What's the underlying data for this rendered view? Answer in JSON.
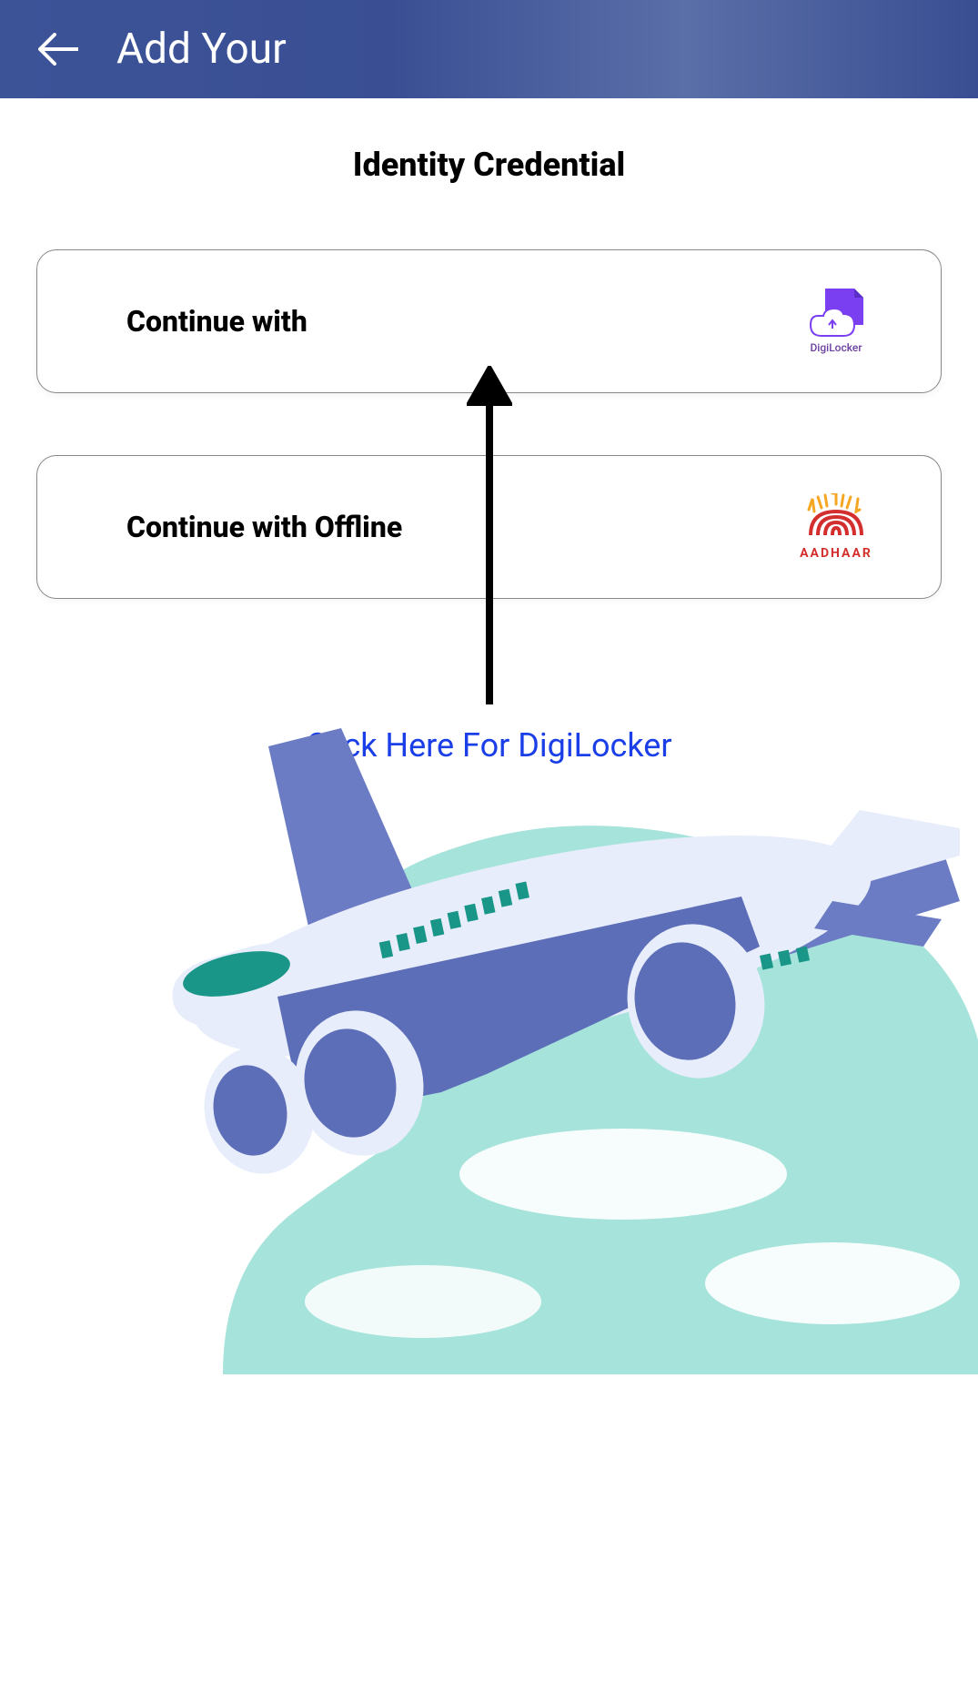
{
  "header": {
    "title": "Add Your"
  },
  "subtitle": "Identity Credential",
  "options": [
    {
      "label": "Continue with",
      "provider": "DigiLocker"
    },
    {
      "label": "Continue with Offline",
      "provider": "AADHAAR"
    }
  ],
  "hint_text": "Click Here For DigiLocker"
}
